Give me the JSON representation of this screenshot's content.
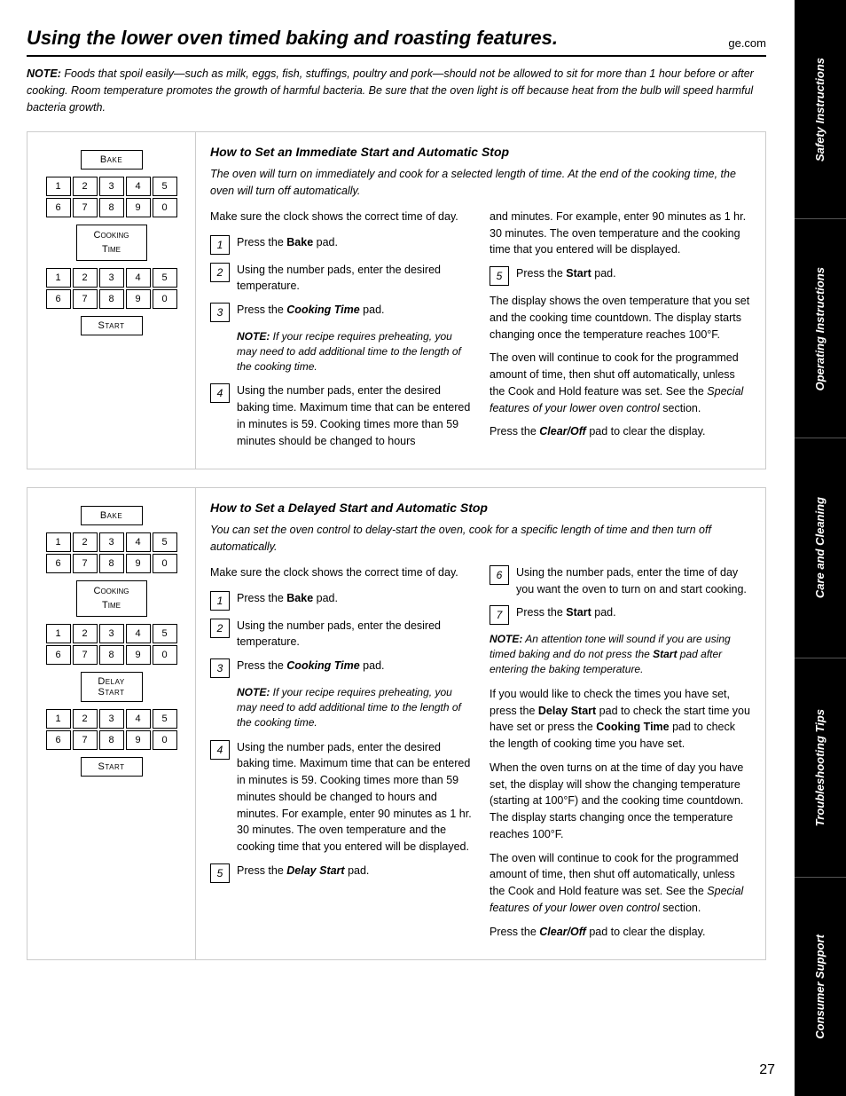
{
  "header": {
    "title": "Using the lower oven timed baking and roasting features.",
    "site": "ge.com"
  },
  "note_top": {
    "label": "NOTE:",
    "text": " Foods that spoil easily—such as milk, eggs, fish, stuffings, poultry and pork—should not be allowed to sit for more than 1 hour before or after cooking. Room temperature promotes the growth of harmful bacteria. Be sure that the oven light is off because heat from the bulb will speed harmful bacteria growth."
  },
  "section1": {
    "title": "How to Set an Immediate Start and Automatic Stop",
    "subtitle": "The oven will turn on immediately and cook for a selected length of time. At the end of the cooking time, the oven will turn off automatically.",
    "make_sure": "Make sure the clock shows the correct time of day.",
    "steps": [
      {
        "num": "1",
        "text_html": "Press the <b>Bake</b> pad."
      },
      {
        "num": "2",
        "text_html": "Using the number pads, enter the desired temperature."
      },
      {
        "num": "3",
        "text_html": "Press the <i><b>Cooking Time</b></i> pad."
      }
    ],
    "note1": "NOTE: If your recipe requires preheating, you may need to add additional time to the length of the cooking time.",
    "step4_html": "Using the number pads, enter the desired baking time. Maximum time that can be entered in minutes is 59. Cooking times more than 59 minutes should be changed to hours",
    "right_col_top": "and minutes. For example, enter 90 minutes as 1 hr. 30 minutes. The oven temperature and the cooking time that you entered will be displayed.",
    "step5_num": "5",
    "step5_html": "Press the <b>Start</b> pad.",
    "right_col_p1": "The display shows the oven temperature that you set and the cooking time countdown. The display starts changing once the temperature reaches 100°F.",
    "right_col_p2": "The oven will continue to cook for the programmed amount of time, then shut off automatically, unless the Cook and Hold feature was set. See the <i>Special features of your lower oven control</i> section.",
    "right_col_p3_html": "Press the <b><i>Clear/Off</i></b> pad to clear the display."
  },
  "section2": {
    "title": "How to Set a Delayed Start and Automatic Stop",
    "subtitle": "You can set the oven control to delay-start the oven, cook for a specific length of time and then turn off automatically.",
    "make_sure": "Make sure the clock shows the correct time of day.",
    "steps": [
      {
        "num": "1",
        "text_html": "Press the <b>Bake</b> pad."
      },
      {
        "num": "2",
        "text_html": "Using the number pads, enter the desired temperature."
      },
      {
        "num": "3",
        "text_html": "Press the <i><b>Cooking Time</b></i> pad."
      }
    ],
    "note1": "NOTE: If your recipe requires preheating, you may need to add additional time to the length of the cooking time.",
    "step4_html": "Using the number pads, enter the desired baking time. Maximum time that can be entered in minutes is 59. Cooking times more than 59 minutes should be changed to hours and minutes. For example, enter 90 minutes as 1 hr. 30 minutes. The oven temperature and the cooking time that you entered will be displayed.",
    "step5_num": "5",
    "step5_html": "Press the <b><i>Delay Start</i></b> pad.",
    "right_step6_num": "6",
    "right_step6_html": "Using the number pads, enter the time of day you want the oven to turn on and start cooking.",
    "right_step7_num": "7",
    "right_step7_html": "Press the <b>Start</b> pad.",
    "right_note_html": "<i><b>NOTE:</b> An attention tone will sound if you are using timed baking and do not press the <b>Start</b> pad after entering the baking temperature.</i>",
    "right_p1": "If you would like to check the times you have set, press the Delay Start pad to check the start time you have set or press the Cooking Time pad to check the length of cooking time you have set.",
    "right_p2": "When the oven turns on at the time of day you have set, the display will show the changing temperature (starting at 100°F) and the cooking time countdown. The display starts changing once the temperature reaches 100°F.",
    "right_p3": "The oven will continue to cook for the programmed amount of time, then shut off automatically, unless the Cook and Hold feature was set. See the Special features of your lower oven control section.",
    "right_p4_html": "Press the <b><i>Clear/Off</i></b> pad to clear the display."
  },
  "sidebar": {
    "items": [
      "Safety Instructions",
      "Operating Instructions",
      "Care and Cleaning",
      "Troubleshooting Tips",
      "Consumer Support"
    ]
  },
  "page_number": "27",
  "diagram1": {
    "bake_label": "Bake",
    "nums_row1": [
      "1",
      "2",
      "3",
      "4",
      "5"
    ],
    "nums_row2": [
      "6",
      "7",
      "8",
      "9",
      "0"
    ],
    "cooking_time_label": "Cooking\nTime",
    "nums2_row1": [
      "1",
      "2",
      "3",
      "4",
      "5"
    ],
    "nums2_row2": [
      "6",
      "7",
      "8",
      "9",
      "0"
    ],
    "start_label": "Start"
  },
  "diagram2": {
    "bake_label": "Bake",
    "nums_row1": [
      "1",
      "2",
      "3",
      "4",
      "5"
    ],
    "nums_row2": [
      "6",
      "7",
      "8",
      "9",
      "0"
    ],
    "cooking_time_label": "Cooking\nTime",
    "nums2_row1": [
      "1",
      "2",
      "3",
      "4",
      "5"
    ],
    "nums2_row2": [
      "6",
      "7",
      "8",
      "9",
      "0"
    ],
    "delay_start_label": "Delay\nStart",
    "nums3_row1": [
      "1",
      "2",
      "3",
      "4",
      "5"
    ],
    "nums3_row2": [
      "6",
      "7",
      "8",
      "9",
      "0"
    ],
    "start_label": "Start"
  }
}
